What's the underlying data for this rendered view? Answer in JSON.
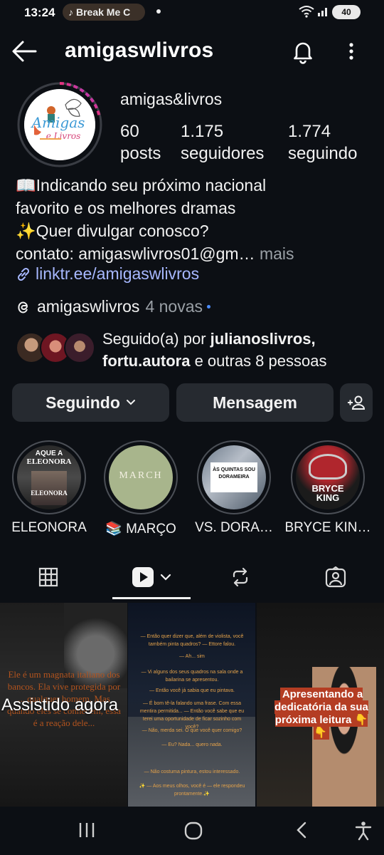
{
  "status_bar": {
    "time": "13:24",
    "media_label": "Break Me C",
    "battery": "40"
  },
  "header": {
    "username": "amigaswlivros"
  },
  "profile": {
    "display_name": "amigas&livros",
    "stats": [
      {
        "count": "60",
        "label": "posts"
      },
      {
        "count": "1.175",
        "label": "seguidores"
      },
      {
        "count": "1.774",
        "label": "seguindo"
      }
    ],
    "bio_lines": [
      "📖Indicando seu próximo nacional",
      "favorito e os melhores dramas",
      "✨Quer divulgar conosco?",
      "contato: amigaswlivros01@gm…"
    ],
    "bio_more": "mais",
    "link": "linktr.ee/amigaswlivros",
    "threads_handle": "amigaswlivros",
    "threads_new": "4 novas",
    "followed_by_prefix": "Seguido(a) por",
    "followed_by_user1": "julianoslivros,",
    "followed_by_user2": "fortu.autora",
    "followed_by_suffix": "e outras 8 pessoas"
  },
  "actions": {
    "following_label": "Seguindo",
    "message_label": "Mensagem"
  },
  "highlights": [
    {
      "label": "ELEONORA",
      "art_top": "AQUE A",
      "art_title": "ELEONORA",
      "art_bottom": "ELEONORA"
    },
    {
      "label": "📚 MARÇO",
      "art_title": "MARCH"
    },
    {
      "label": "VS. DORA…",
      "art_title": "ÀS QUINTAS SOU DORAMEIRA"
    },
    {
      "label": "BRYCE KIN…",
      "art_title": "BRYCE KING"
    }
  ],
  "grid": [
    {
      "overlay": "Ele é um magnata italiano dos bancos. Ela vive protegida por ... qualquer homem. Mas quando eles se conhecem, essa é a reação dele...",
      "status": "Assistido agora"
    },
    {
      "overlay_lines": [
        "— Então quer dizer que, além de violista, você também pinta quadros? — Ettore falou.",
        "— Ah... sim",
        "— Vi alguns dos seus quadros na sala onde a bailarina se apresentou.",
        "— Então você já sabia que eu pintava.",
        "— É bom tê-la falando uma frase. Com essa mentira permitida... — Então você sabe que eu terei uma oportunidade de ficar sozinho com você?",
        "— Não, merda sei. O que você quer comigo?",
        "— Eu? Nada... quero nada.",
        "— Não costuma pintura, estou interessado.",
        "✨ — Aos meus olhos, você é — ele respondeu prontamente.✨"
      ]
    },
    {
      "overlay": "Apresentando a dedicatória da sua próxima leitura 👇👇"
    }
  ],
  "colors": {
    "background": "#0c0f14",
    "button": "#262a30",
    "link": "#a7b8ff",
    "story_ring_gradient": [
      "#f8c33f",
      "#e9337b",
      "#8b3ff2"
    ]
  }
}
